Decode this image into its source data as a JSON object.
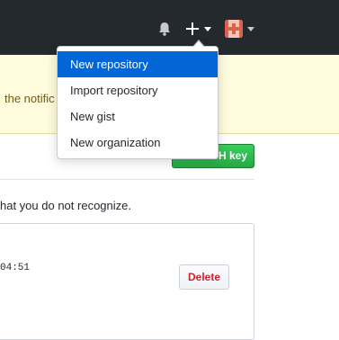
{
  "header": {
    "bell_icon": "bell-icon",
    "plus_icon": "plus-icon",
    "avatar_icon": "avatar-icon",
    "caret_icon": "caret-down-icon"
  },
  "flash": {
    "text": "the notific"
  },
  "page": {
    "green_button_label": "New SSH key",
    "notice_text": "hat you do not recognize.",
    "key_time": "04:51",
    "delete_label": "Delete"
  },
  "dropdown": {
    "items": [
      {
        "label": "New repository",
        "active": true
      },
      {
        "label": "Import repository",
        "active": false
      },
      {
        "label": "New gist",
        "active": false
      },
      {
        "label": "New organization",
        "active": false
      }
    ]
  },
  "colors": {
    "header_bg": "#24292e",
    "flash_bg": "#fffbdd",
    "active_item_bg": "#0366d6",
    "primary_green": "#28a745",
    "danger_red": "#cb2431"
  }
}
